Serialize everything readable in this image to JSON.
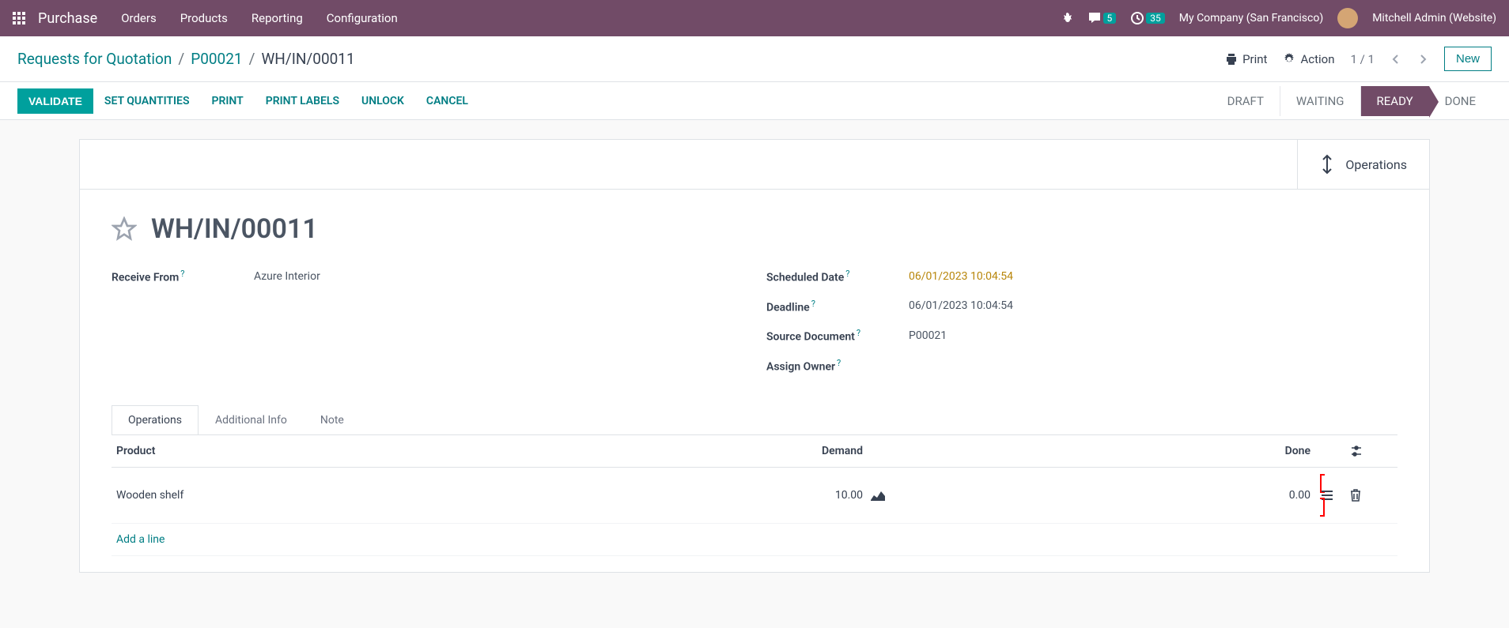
{
  "nav": {
    "brand": "Purchase",
    "items": [
      "Orders",
      "Products",
      "Reporting",
      "Configuration"
    ],
    "messages_count": "5",
    "activities_count": "35",
    "company": "My Company (San Francisco)",
    "user": "Mitchell Admin (Website)"
  },
  "breadcrumb": {
    "root": "Requests for Quotation",
    "mid": "P00021",
    "current": "WH/IN/00011"
  },
  "controls": {
    "print": "Print",
    "action": "Action",
    "pager": "1 / 1",
    "new": "New"
  },
  "actions": {
    "validate": "VALIDATE",
    "set_qty": "SET QUANTITIES",
    "print": "PRINT",
    "print_labels": "PRINT LABELS",
    "unlock": "UNLOCK",
    "cancel": "CANCEL"
  },
  "status": [
    "DRAFT",
    "WAITING",
    "READY",
    "DONE"
  ],
  "operations_btn": "Operations",
  "record": {
    "title": "WH/IN/00011",
    "receive_from_label": "Receive From",
    "receive_from": "Azure Interior",
    "scheduled_label": "Scheduled Date",
    "scheduled": "06/01/2023 10:04:54",
    "deadline_label": "Deadline",
    "deadline": "06/01/2023 10:04:54",
    "source_label": "Source Document",
    "source": "P00021",
    "assign_label": "Assign Owner"
  },
  "tabs": [
    "Operations",
    "Additional Info",
    "Note"
  ],
  "table": {
    "headers": {
      "product": "Product",
      "demand": "Demand",
      "done": "Done"
    },
    "rows": [
      {
        "product": "Wooden shelf",
        "demand": "10.00",
        "done": "0.00"
      }
    ],
    "add_line": "Add a line"
  }
}
